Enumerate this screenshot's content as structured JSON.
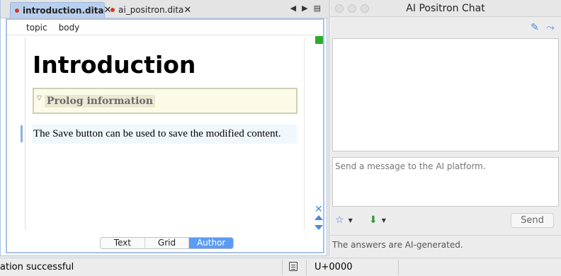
{
  "editor": {
    "tabs": [
      {
        "label": "introduction.dita",
        "active": true
      },
      {
        "label": "ai_positron.dita",
        "active": false
      }
    ],
    "tab_tools": {
      "prev": "◀",
      "next": "▶",
      "menu": "▤"
    },
    "breadcrumb": [
      "topic",
      "body"
    ],
    "document": {
      "title": "Introduction",
      "prolog_label": "Prolog information",
      "paragraph": "The Save button can be used to save the modified content."
    },
    "modes": [
      "Text",
      "Grid",
      "Author"
    ],
    "active_mode": "Author"
  },
  "chat": {
    "title": "AI Positron Chat",
    "input_placeholder": "Send a message to the AI platform.",
    "send_label": "Send",
    "footer": "The answers are AI-generated."
  },
  "status": {
    "message": "ation successful",
    "encoding": "U+0000"
  },
  "colors": {
    "accent": "#4d8ad6",
    "active_tab": "#b9cfee",
    "active_mode": "#5b9bf3",
    "modified_dot": "#d23a2a",
    "validation_ok": "#2eaa2e"
  }
}
